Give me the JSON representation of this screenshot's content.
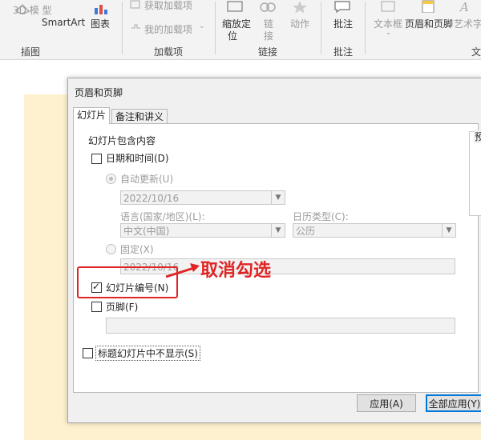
{
  "ribbon": {
    "items": {
      "model3d": "3D 模\n型",
      "smartart": "SmartArt",
      "chart": "图表",
      "get_addins": "获取加载项",
      "my_addins": "我的加载项",
      "zoom_line1": "缩放定",
      "zoom_line2": "位",
      "link_line1": "链",
      "link_line2": "接",
      "action": "动作",
      "comment": "批注",
      "textbox": "文本框",
      "header_footer": "页眉和页脚",
      "wordart": "艺术字"
    },
    "groups": {
      "illustrations": "插图",
      "addins": "加载项",
      "links": "链接",
      "comments": "批注",
      "text": "文"
    }
  },
  "dialog": {
    "title": "页眉和页脚",
    "tabs": [
      "幻灯片",
      "备注和讲义"
    ],
    "section_title": "幻灯片包含内容",
    "date_time": {
      "label": "日期和时间(D)",
      "checked": false
    },
    "auto_update": {
      "label": "自动更新(U)",
      "selected": true
    },
    "date_value": "2022/10/16",
    "language_label": "语言(国家/地区)(L):",
    "language_value": "中文(中国)",
    "calendar_label": "日历类型(C):",
    "calendar_value": "公历",
    "fixed": {
      "label": "固定(X)",
      "selected": false
    },
    "fixed_value": "2022/10/16",
    "slide_number": {
      "label": "幻灯片编号(N)",
      "checked": true
    },
    "footer": {
      "label": "页脚(F)",
      "checked": false
    },
    "footer_value": "",
    "dont_show_title": {
      "label": "标题幻灯片中不显示(S)",
      "checked": false
    },
    "preview_label": "预",
    "buttons": {
      "apply": "应用(A)",
      "apply_all": "全部应用(Y)"
    }
  },
  "annotation": {
    "text": "取消勾选",
    "color": "#e02424"
  }
}
